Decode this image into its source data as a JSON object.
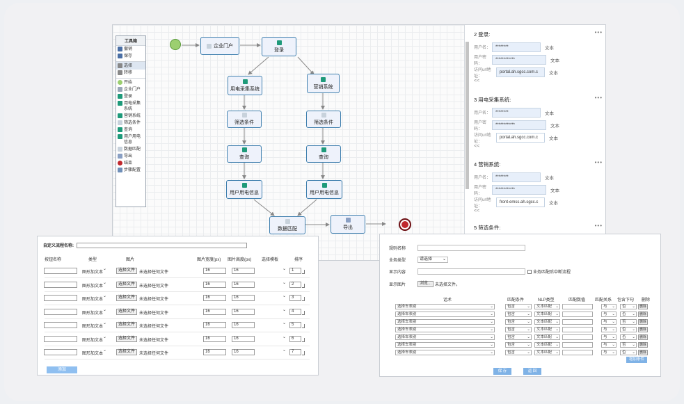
{
  "toolbox": {
    "title": "工具箱",
    "items": [
      {
        "label": "撤销",
        "icon": "undo-icon",
        "color": "#4a6fa5"
      },
      {
        "label": "保存",
        "icon": "save-icon",
        "color": "#4a6fa5"
      },
      {
        "label": "选择",
        "icon": "select-icon",
        "color": "#888888",
        "active": true,
        "divider": true
      },
      {
        "label": "转移",
        "icon": "transition-icon",
        "color": "#888888"
      },
      {
        "label": "开始",
        "icon": "start-icon",
        "color": "#9ccf70",
        "divider": true
      },
      {
        "label": "企业门户",
        "icon": "portal-icon",
        "color": "#9aa7b8"
      },
      {
        "label": "登录",
        "icon": "login-icon",
        "color": "#1e9a7a"
      },
      {
        "label": "用电采集系统",
        "icon": "collect-system-icon",
        "color": "#1e9a7a"
      },
      {
        "label": "营销系统",
        "icon": "marketing-system-icon",
        "color": "#1e9a7a"
      },
      {
        "label": "筛选条件",
        "icon": "filter-icon",
        "color": "#c8d2dc"
      },
      {
        "label": "查询",
        "icon": "query-icon",
        "color": "#1e9a7a"
      },
      {
        "label": "用户用电信息",
        "icon": "user-info-icon",
        "color": "#1e9a7a"
      },
      {
        "label": "数据匹配",
        "icon": "match-icon",
        "color": "#c8d2dc"
      },
      {
        "label": "导出",
        "icon": "export-icon",
        "color": "#8aa0c4"
      },
      {
        "label": "结束",
        "icon": "end-icon",
        "color": "#c0272d"
      },
      {
        "label": "步骤配置",
        "icon": "config-icon",
        "color": "#6f8fb8"
      }
    ]
  },
  "flow": {
    "nodes": {
      "portal": "企业门户",
      "login": "登录",
      "collect": "用电采集系统",
      "marketing": "营销系统",
      "filter_left": "筛选条件",
      "filter_right": "筛选条件",
      "query_left": "查询",
      "query_right": "查询",
      "info_left": "用户用电信息",
      "info_right": "用户用电信息",
      "match": "数据匹配",
      "export": "导出"
    }
  },
  "props": {
    "sections": [
      {
        "title": "2 登录:",
        "rows": [
          {
            "label": "用户名：",
            "value": "********",
            "type": "文本",
            "filled": true
          },
          {
            "label": "用户密码：",
            "value": "************",
            "type": "文本",
            "filled": true
          },
          {
            "label": "访问url地址：",
            "value": "portal.ah.sgcc.com.c",
            "type": "文本",
            "filled": true
          }
        ]
      },
      {
        "title": "3 用电采集系统:",
        "rows": [
          {
            "label": "用户名：",
            "value": "********",
            "type": "文本",
            "filled": true
          },
          {
            "label": "用户密码：",
            "value": "************",
            "type": "文本",
            "filled": true
          },
          {
            "label": "访问url地址：",
            "value": "portal.ah.sgcc.com.c",
            "type": "文本",
            "filled": false
          }
        ]
      },
      {
        "title": "4 营销系统:",
        "rows": [
          {
            "label": "用户名：",
            "value": "********",
            "type": "文本",
            "filled": true
          },
          {
            "label": "用户密码：",
            "value": "************",
            "type": "文本",
            "filled": true
          },
          {
            "label": "访问url地址：",
            "value": "front-emss.ah.sgcc.c",
            "type": "文本",
            "filled": false
          }
        ]
      },
      {
        "title": "5 筛选条件:",
        "rows": []
      }
    ],
    "collapse": "<<",
    "dots": "•••"
  },
  "formA": {
    "name_label": "自定义流程名称:",
    "headers": [
      "按钮名称",
      "类型",
      "图片",
      "图片宽度(px)",
      "图片高度(px)",
      "选择模板",
      "排序"
    ],
    "type_value": "图形加文本",
    "file_button": "选择文件",
    "file_note": "未选择任何文件",
    "rows": [
      {
        "width": "16",
        "height": "16",
        "order": "1"
      },
      {
        "width": "16",
        "height": "16",
        "order": "2"
      },
      {
        "width": "16",
        "height": "16",
        "order": "3"
      },
      {
        "width": "16",
        "height": "16",
        "order": "4"
      },
      {
        "width": "16",
        "height": "16",
        "order": "5"
      },
      {
        "width": "16",
        "height": "16",
        "order": "6"
      },
      {
        "width": "16",
        "height": "16",
        "order": "7"
      }
    ],
    "add_button": "添加"
  },
  "formB": {
    "rule_name_label": "规则名称",
    "biz_type_label": "业务类型",
    "biz_type_value": "请选择",
    "display_label": "显示内容",
    "interrupt_label": "业务匹配后中断流程",
    "image_label": "显示图片",
    "browse": "浏览...",
    "no_file": "未选择文件。",
    "headers": [
      "话术",
      "匹配条件",
      "NLP类型",
      "匹配数值",
      "匹配关系",
      "包含下句",
      "删除"
    ],
    "row_template": {
      "speech": "选择车表别",
      "cond": "包含",
      "nlp": "文本匹配",
      "rel": "与",
      "next": "否",
      "del": "删除"
    },
    "row_count": 7,
    "add_condition": "增加条件",
    "save": "保 存",
    "back": "返 回"
  }
}
